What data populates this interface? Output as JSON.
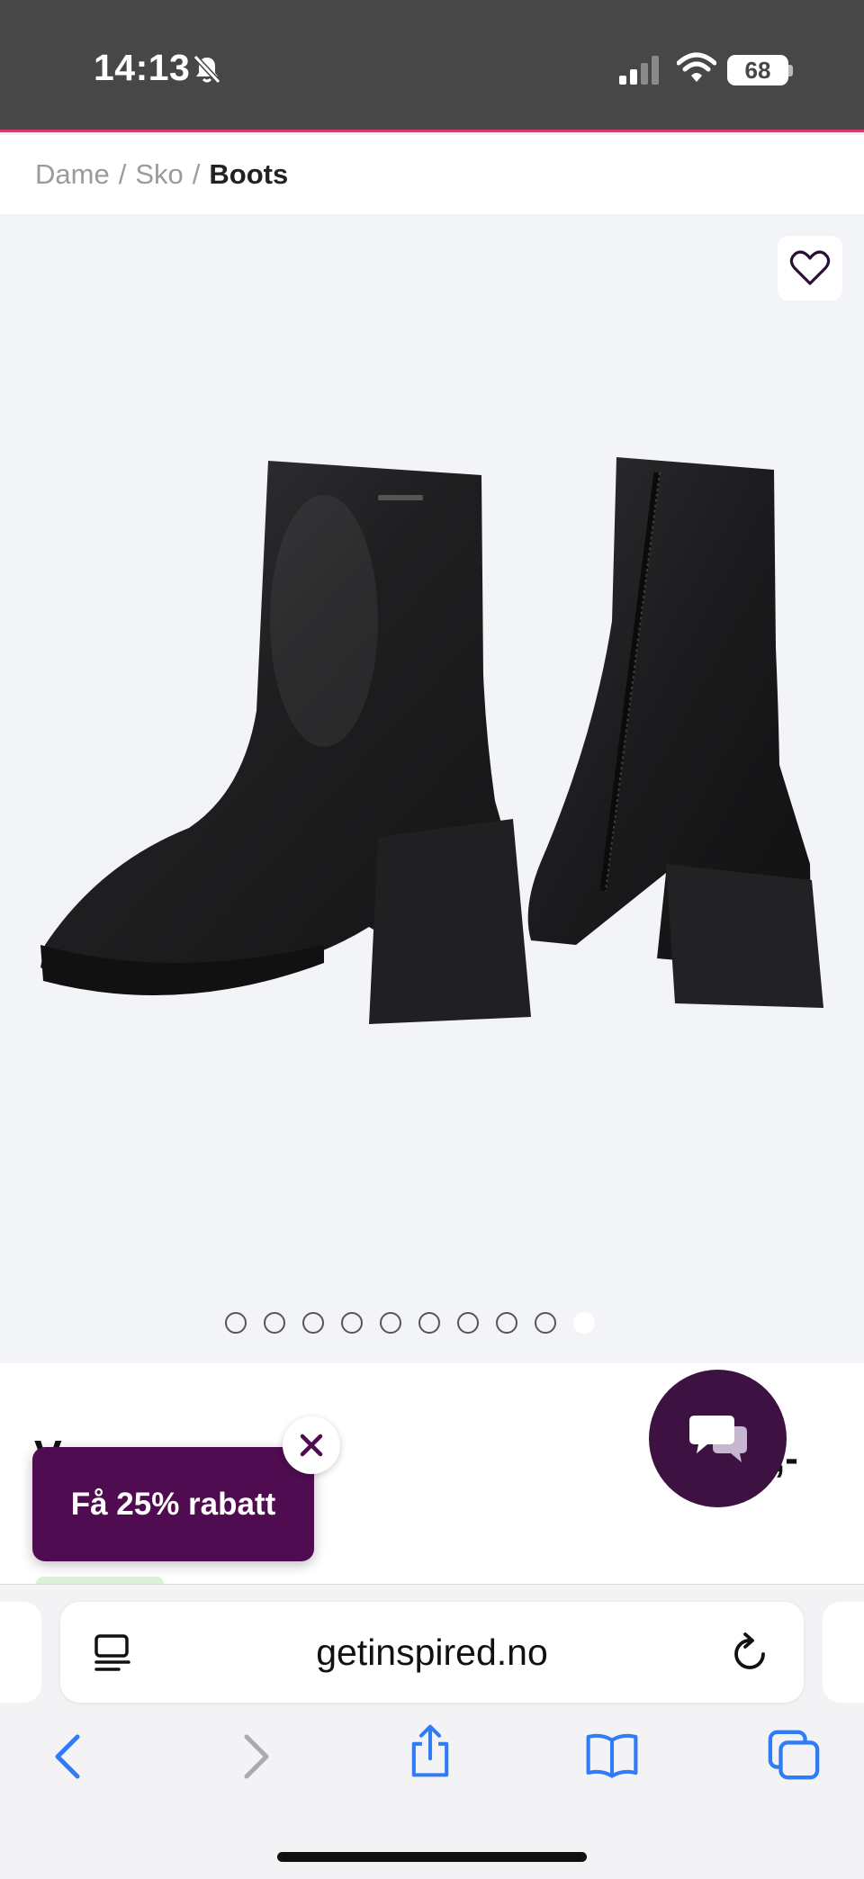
{
  "status_bar": {
    "time": "14:13",
    "battery": "68",
    "icons": [
      "mute-bell-icon",
      "cellular-signal-icon",
      "wifi-icon",
      "battery-icon"
    ]
  },
  "breadcrumb": {
    "items": [
      {
        "label": "Dame"
      },
      {
        "label": "Sko"
      },
      {
        "label": "Boots"
      }
    ],
    "separator": "/"
  },
  "product": {
    "image_alt_icon": "ankle-boots-image",
    "carousel": {
      "total": 10,
      "active_index": 9
    },
    "title_partial": "V",
    "price_partial": ",-"
  },
  "promo": {
    "label": "Få 25% rabatt",
    "close_icon": "close-icon"
  },
  "chat": {
    "icon": "chat-bubbles-icon"
  },
  "browser": {
    "url": "getinspired.no",
    "icons": [
      "reader-icon",
      "reload-icon",
      "back-icon",
      "forward-icon",
      "share-icon",
      "bookmarks-icon",
      "tabs-icon"
    ]
  },
  "colors": {
    "status_bg": "#474747",
    "accent_line": "#d63c6a",
    "promo_bg": "#4f0c50",
    "chat_bg": "#3d1243",
    "ios_blue": "#2f7cf6"
  }
}
